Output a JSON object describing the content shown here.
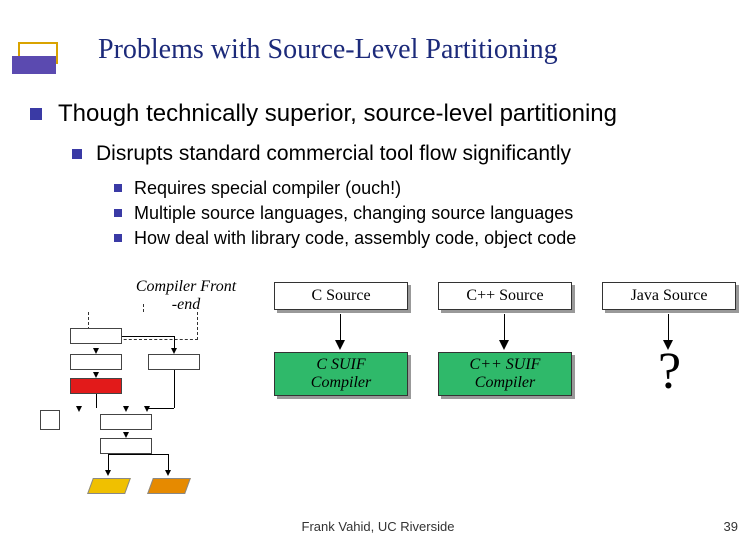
{
  "title": "Problems with Source-Level Partitioning",
  "bullets": {
    "l1": "Though technically superior, source-level partitioning",
    "l2": "Disrupts standard commercial tool flow significantly",
    "l3a": "Requires special compiler (ouch!)",
    "l3b": "Multiple source languages, changing source languages",
    "l3c": "How deal with library code, assembly code, object code"
  },
  "diagram": {
    "compiler_front_end": "Compiler Front\n-end",
    "c_source": "C Source",
    "cpp_source": "C++ Source",
    "java_source": "Java Source",
    "c_suif": "C SUIF\nCompiler",
    "cpp_suif": "C++ SUIF\nCompiler",
    "question": "?"
  },
  "footer": {
    "credit": "Frank Vahid, UC Riverside",
    "page": "39"
  }
}
